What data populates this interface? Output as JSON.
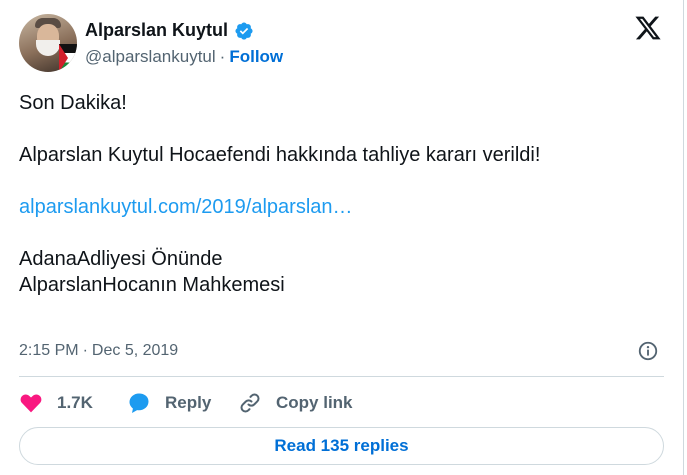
{
  "author": {
    "name": "Alparslan Kuytul",
    "handle": "@alparslankuytul",
    "separator": "·",
    "follow_label": "Follow"
  },
  "tweet": {
    "lines": [
      "Son Dakika!",
      "Alparslan Kuytul Hocaefendi hakkında tahliye kararı verildi!",
      "alparslankuytul.com/2019/alparslan…",
      "AdanaAdliyesi Önünde",
      "AlparslanHocanın Mahkemesi"
    ]
  },
  "meta": {
    "time": "2:15 PM",
    "separator": "·",
    "date": "Dec 5, 2019"
  },
  "actions": {
    "like_count": "1.7K",
    "reply_label": "Reply",
    "copy_link_label": "Copy link"
  },
  "read_replies_label": "Read 135 replies",
  "colors": {
    "link": "#1d9bf0",
    "follow": "#006fd6",
    "like": "#f91880",
    "verified": "#1d9bf0",
    "secondary_text": "#536471"
  },
  "icons": [
    "verified-badge-icon",
    "x-logo-icon",
    "info-icon",
    "heart-icon",
    "reply-bubble-icon",
    "link-icon"
  ]
}
